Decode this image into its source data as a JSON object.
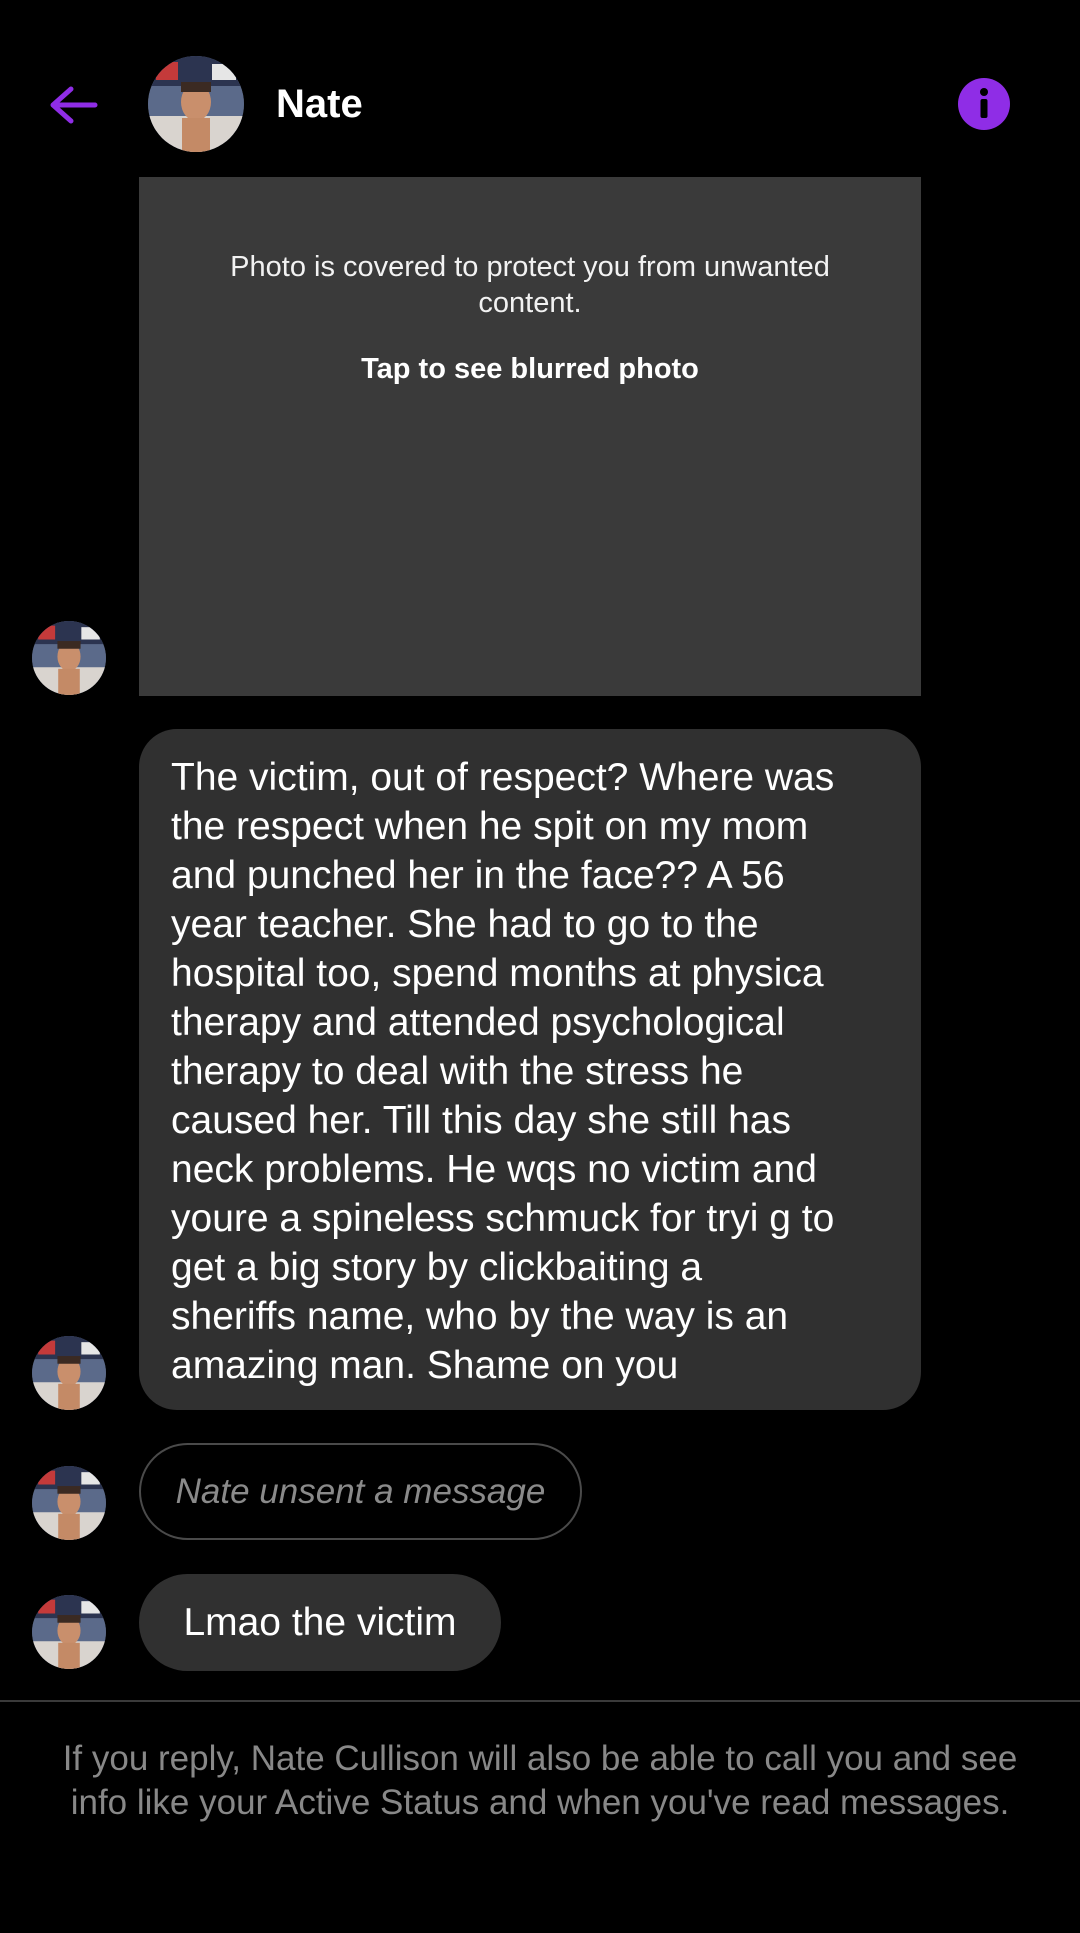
{
  "header": {
    "contact_name": "Nate",
    "back_icon": "arrow-left-icon",
    "info_icon": "info-icon"
  },
  "colors": {
    "accent": "#8f2de6",
    "bubble": "#303030",
    "covered_bg": "#3a3a3a",
    "muted_text": "#888888"
  },
  "thread": {
    "covered_photo": {
      "notice": "Photo is covered to protect you from unwanted content.",
      "cta": "Tap to see blurred photo"
    },
    "messages": [
      {
        "text": "The victim, out of respect? Where was\nthe respect when he spit on my mom\nand punched her in the face?? A 56\nyear teacher. She had to go to the\nhospital too, spend months at physica\ntherapy and attended psychological\ntherapy to deal with the stress he\ncaused her. Till this day she still has\nneck problems. He wqs no victim and\nyoure a spineless schmuck for tryi g to\nget a big story by clickbaiting a\nsheriffs name, who by the way is an\namazing man. Shame on you"
      },
      {
        "text": "Nate unsent a message"
      },
      {
        "text": "Lmao the victim"
      }
    ]
  },
  "footer": {
    "notice": "If you reply, Nate Cullison will also be able to call you and see info like your Active Status and when you've read messages."
  }
}
